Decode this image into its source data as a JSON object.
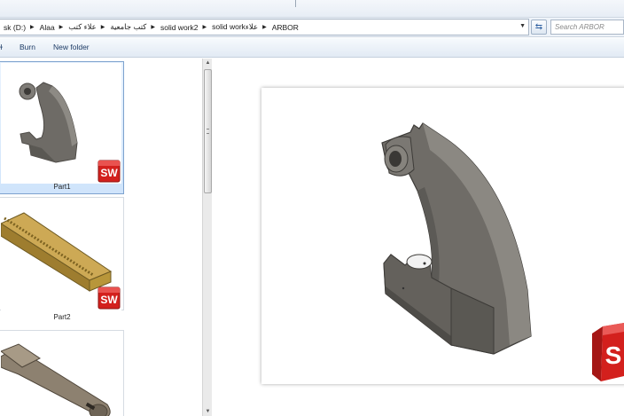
{
  "breadcrumb": {
    "items": [
      "sk (D:)",
      "Alaa",
      "علاء كتب",
      "كتب جامعية",
      "solid work2",
      "solid workعلاء",
      "ARBOR"
    ]
  },
  "search": {
    "placeholder": "Search ARBOR"
  },
  "toolbar": {
    "items": [
      "Burn",
      "New folder"
    ]
  },
  "files": [
    {
      "name": "Part1",
      "icon": "arbor-bracket-thumbnail",
      "selected": true
    },
    {
      "name": "Part2",
      "icon": "gear-rack-thumbnail",
      "selected": false
    },
    {
      "name": "",
      "icon": "pinion-shaft-thumbnail",
      "selected": false
    }
  ],
  "badge": {
    "label": "SW"
  },
  "preview": {
    "icon": "arbor-bracket-preview"
  },
  "colors": {
    "part_gray": "#7a7772",
    "sw_red": "#d3201d",
    "rack_gold": "#b8963a",
    "selection": "#cfe4fb"
  }
}
